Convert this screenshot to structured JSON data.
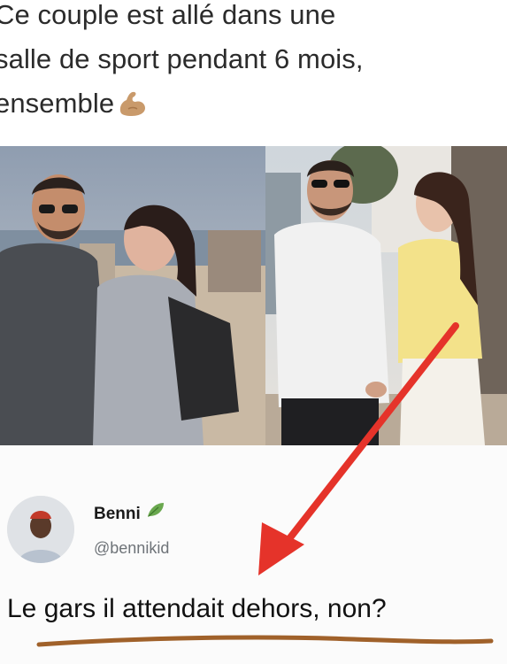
{
  "caption": {
    "lines": [
      "Ce couple est allé dans une",
      "salle de sport pendant 6 mois,",
      "ensemble"
    ]
  },
  "post": {
    "author_name": "Benni",
    "author_handle": "@bennikid",
    "text": "Le gars il attendait dehors, non?"
  },
  "icons": {
    "flexed_biceps": "flexed-biceps-emoji-icon",
    "name_badge": "leaf-emoji-icon"
  },
  "colors": {
    "arrow": "#e5332a",
    "underline": "#a0612a",
    "handle": "#6e7378"
  }
}
